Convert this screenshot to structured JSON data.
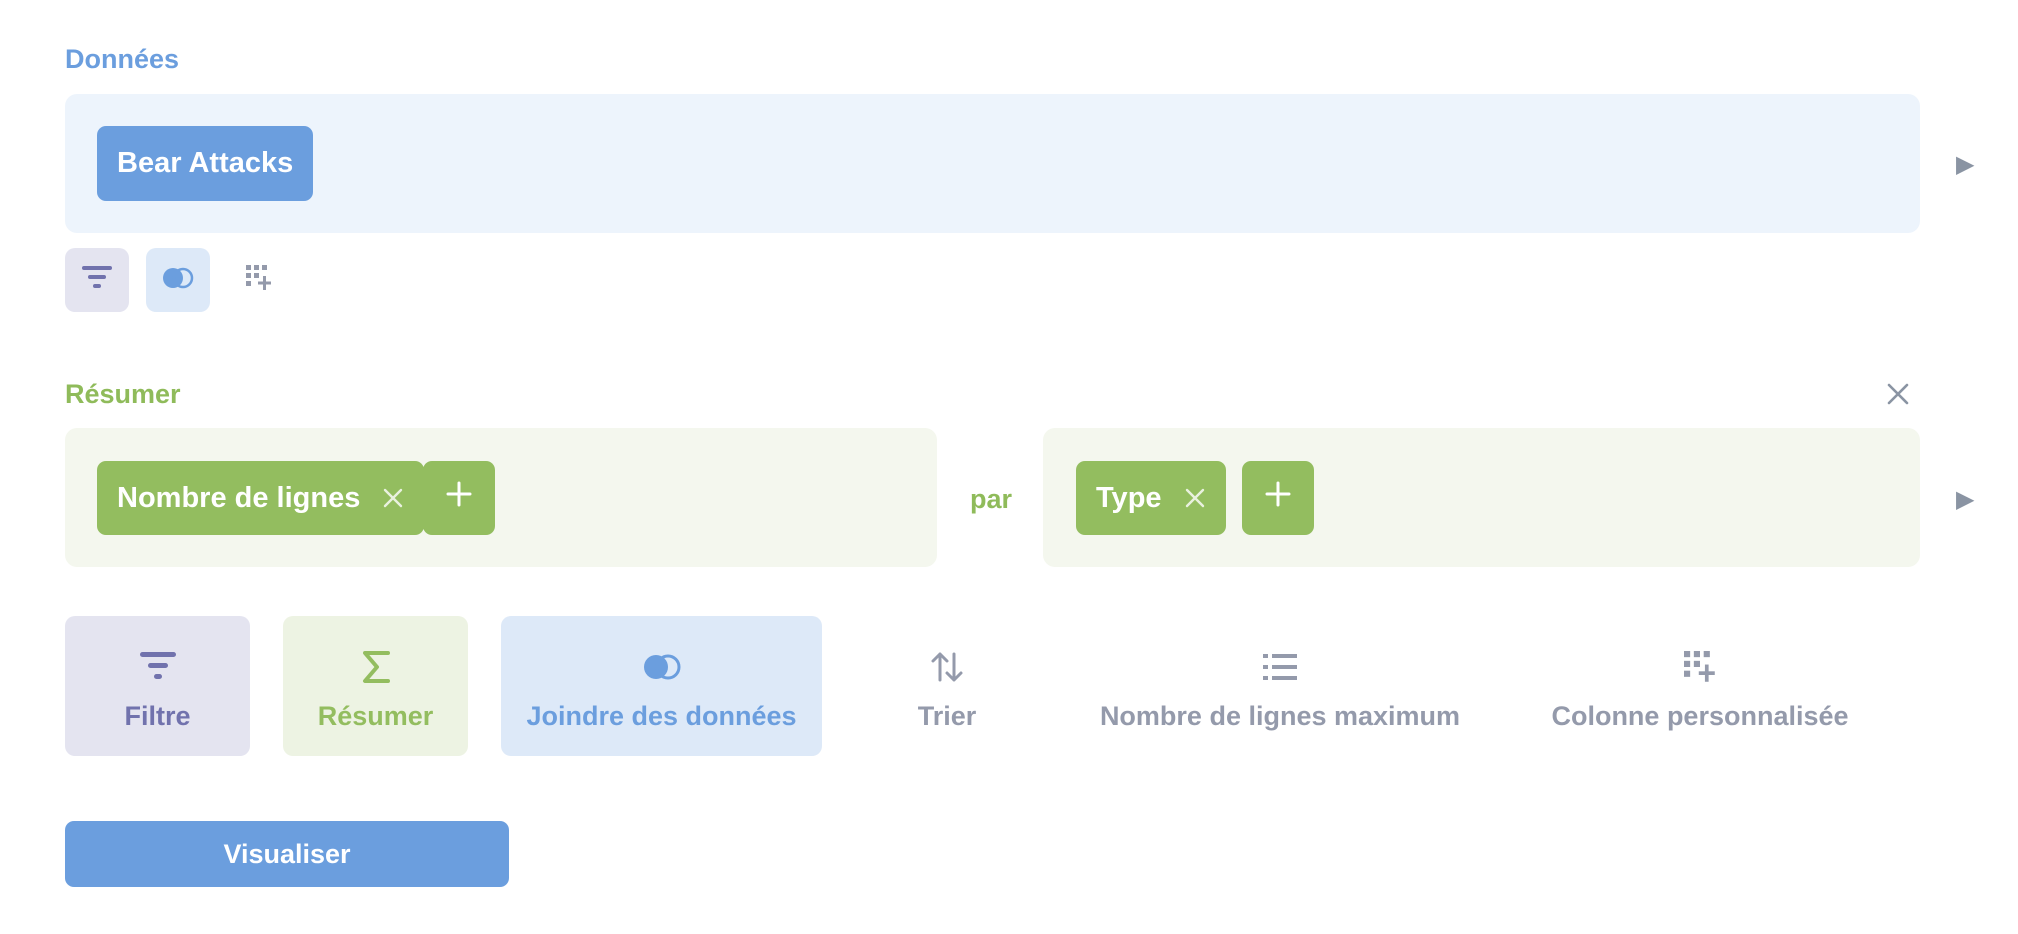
{
  "data_section": {
    "title": "Données",
    "table_name": "Bear Attacks",
    "toolbar_icons": [
      "filter-icon",
      "join-icon",
      "custom-column-icon"
    ]
  },
  "summarize_section": {
    "title": "Résumer",
    "metric": "Nombre de lignes",
    "by_label": "par",
    "breakout": "Type"
  },
  "actions": {
    "filter": "Filtre",
    "summarize": "Résumer",
    "join": "Joindre des données",
    "sort": "Trier",
    "limit": "Nombre de lignes maximum",
    "custom_column": "Colonne personnalisée"
  },
  "visualize_button": "Visualiser",
  "colors": {
    "blue": "#6b9ede",
    "green": "#93bd5f",
    "purple": "#7172ad",
    "gray": "#949aab"
  }
}
